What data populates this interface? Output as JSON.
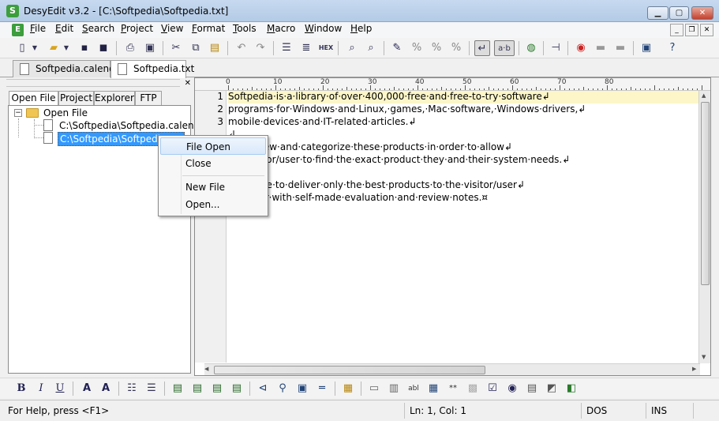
{
  "window": {
    "title": "DesyEdit v3.2 - [C:\\Softpedia\\Softpedia.txt]",
    "app_icon": "S",
    "minimize": "▁",
    "maximize": "▢",
    "close": "✕"
  },
  "menu": [
    "File",
    "Edit",
    "Search",
    "Project",
    "View",
    "Format",
    "Tools",
    "Macro",
    "Window",
    "Help"
  ],
  "mdi_controls": [
    "_",
    "❐",
    "✕"
  ],
  "doc_tabs": [
    {
      "label": "Softpedia.calendar",
      "active": false
    },
    {
      "label": "Softpedia.txt",
      "active": true
    }
  ],
  "left_pane": {
    "close": "✕",
    "tabs": [
      "Open File",
      "Project",
      "Explorer",
      "FTP"
    ],
    "tree": {
      "root": "Open File",
      "items": [
        "C:\\Softpedia\\Softpedia.calendar",
        "C:\\Softpedia\\Softpedia.txt"
      ]
    }
  },
  "ruler": {
    "labels": [
      "0",
      "10",
      "20",
      "30",
      "40",
      "50",
      "60",
      "70",
      "80"
    ]
  },
  "editor": {
    "line_numbers": [
      "1",
      "2",
      "3"
    ],
    "lines": [
      "Softpedia·is·a·library·of·over·400,000·free·and·free-to-try·software",
      "programs·for·Windows·and·Linux,·games,·Mac·software,·Windows·drivers,",
      "mobile·devices·and·IT-related·articles.",
      "",
      "We·review·and·categorize·these·products·in·order·to·allow",
      "the·visitor/user·to·find·the·exact·product·they·and·their·system·needs.",
      "",
      "We·strive·to·deliver·only·the·best·products·to·the·visitor/user",
      "together·with·self-made·evaluation·and·review·notes."
    ],
    "line_end_mark": "↲",
    "eof_mark": "¤"
  },
  "context_menu": [
    "File Open",
    "Close",
    "New File",
    "Open..."
  ],
  "status": {
    "help": "For Help, press <F1>",
    "position": "Ln: 1, Col: 1",
    "format": "DOS",
    "mode": "INS"
  },
  "toolbar_icons": [
    "new-icon",
    "new-dropdown-icon",
    "open-icon",
    "open-dropdown-icon",
    "save-icon",
    "save-all-icon",
    "print-icon",
    "print-preview-icon",
    "cut-icon",
    "copy-icon",
    "paste-icon",
    "undo-icon",
    "redo-icon",
    "file-list-icon",
    "list-icon",
    "hex-icon",
    "find-icon",
    "find-next-icon",
    "highlight-icon",
    "tag-icon",
    "tag-2-icon",
    "tag-3-icon",
    "word-wrap-icon",
    "ab-icon",
    "globe-icon",
    "pin-icon",
    "macro-record-icon",
    "comment-icon",
    "comment-2-icon",
    "browser-icon",
    "help-icon"
  ],
  "format_icons": [
    "bold-icon",
    "italic-icon",
    "underline-icon",
    "font-icon",
    "font-color-icon",
    "bullets-icon",
    "numbered-list-icon",
    "align-left-icon",
    "align-center-icon",
    "align-right-icon",
    "justify-icon",
    "anchor-icon",
    "link-icon",
    "image-icon",
    "hr-icon",
    "table-icon",
    "form-icon",
    "textarea-icon",
    "text-field-icon",
    "grid-icon",
    "password-icon",
    "hidden-icon",
    "checkbox-icon",
    "radio-icon",
    "listbox-icon",
    "submit-icon",
    "reset-icon"
  ],
  "colors": {
    "current_line": "#fcf6c8",
    "selection": "#3399ff",
    "title_bar": "#c6d9ef"
  }
}
